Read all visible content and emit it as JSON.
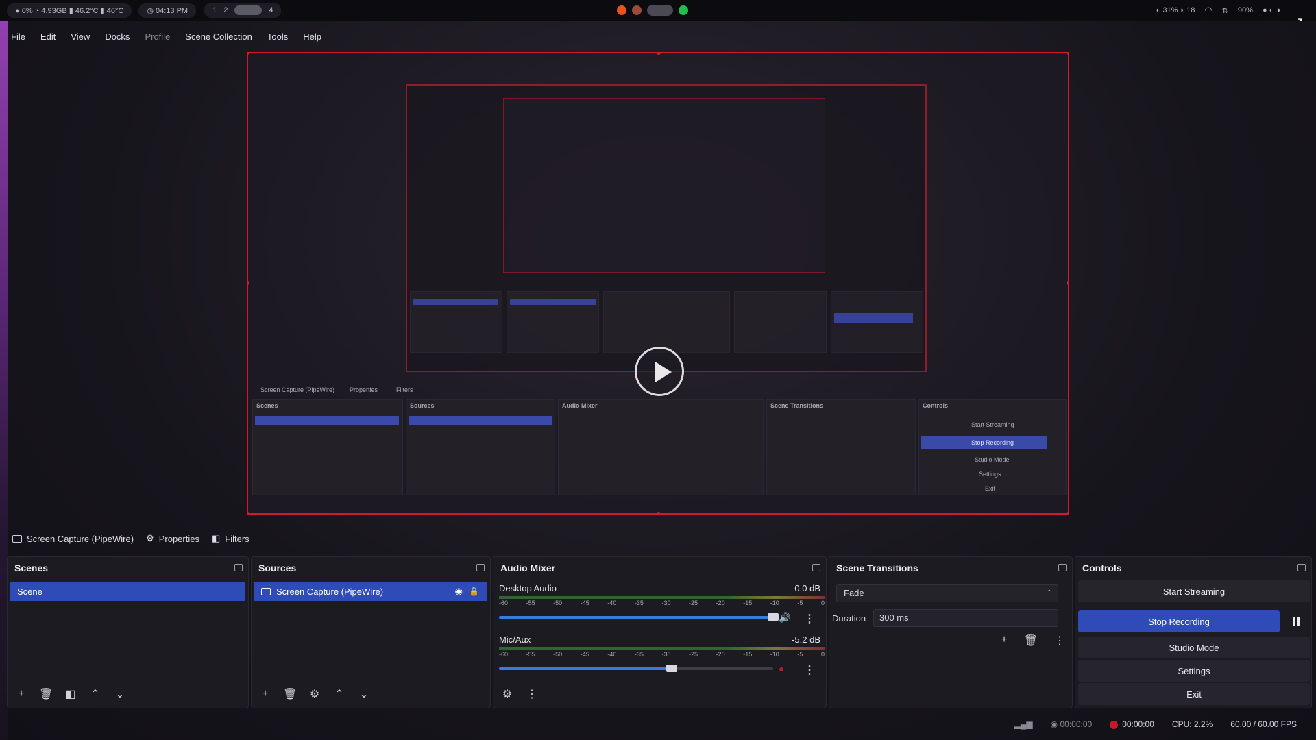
{
  "sysbar": {
    "stats": "● 6%  ◔ 4.93GB  ▮ 46.2°C  ▮ 46°C",
    "clock": "◷ 04:13 PM",
    "workspaces": [
      "1",
      "2",
      "4"
    ],
    "right_info": "◐ 31%   ◗ 18",
    "battery": "90%",
    "colors": {
      "firefox": "#e8541c",
      "green_app": "#1fbf4f"
    }
  },
  "menu": {
    "items": [
      "File",
      "Edit",
      "View",
      "Docks",
      "Profile",
      "Scene Collection",
      "Tools",
      "Help"
    ]
  },
  "preview": {
    "nested_labels": {
      "source": "Screen Capture (PipeWire)",
      "properties": "Properties",
      "filters": "Filters",
      "scenes": "Scenes",
      "sources": "Sources",
      "mixer": "Audio Mixer",
      "transitions": "Scene Transitions",
      "controls": "Controls",
      "start_streaming": "Start Streaming",
      "stop_recording": "Stop Recording",
      "studio_mode": "Studio Mode",
      "settings": "Settings",
      "exit": "Exit"
    }
  },
  "source_toolbar": {
    "source_name": "Screen Capture (PipeWire)",
    "properties": "Properties",
    "filters": "Filters"
  },
  "scenes": {
    "title": "Scenes",
    "items": [
      "Scene"
    ]
  },
  "sources": {
    "title": "Sources",
    "items": [
      "Screen Capture (PipeWire)"
    ]
  },
  "mixer": {
    "title": "Audio Mixer",
    "scale": [
      "-60",
      "-55",
      "-50",
      "-45",
      "-40",
      "-35",
      "-30",
      "-25",
      "-20",
      "-15",
      "-10",
      "-5",
      "0"
    ],
    "channels": [
      {
        "name": "Desktop Audio",
        "db": "0.0 dB",
        "volume": 1.0
      },
      {
        "name": "Mic/Aux",
        "db": "-5.2 dB",
        "volume": 0.63
      }
    ]
  },
  "transitions": {
    "title": "Scene Transitions",
    "selected": "Fade",
    "duration_label": "Duration",
    "duration_value": "300 ms"
  },
  "controls": {
    "title": "Controls",
    "start_streaming": "Start Streaming",
    "stop_recording": "Stop Recording",
    "studio_mode": "Studio Mode",
    "settings": "Settings",
    "exit": "Exit"
  },
  "status": {
    "stream_time": "00:00:00",
    "rec_time": "00:00:00",
    "cpu": "CPU: 2.2%",
    "fps": "60.00 / 60.00 FPS"
  }
}
